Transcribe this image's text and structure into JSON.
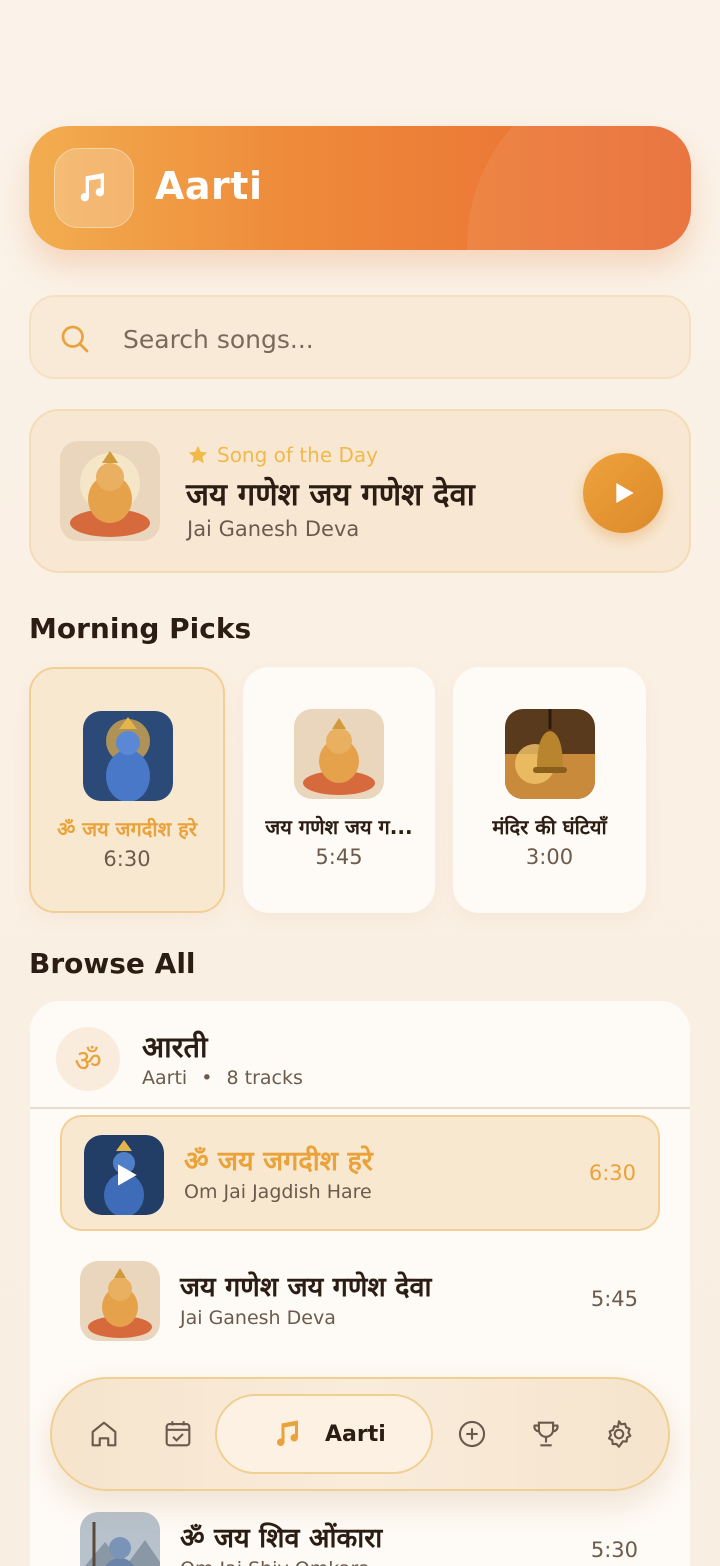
{
  "header": {
    "title": "Aarti",
    "icon": "music-note-icon"
  },
  "search": {
    "placeholder": "Search songs..."
  },
  "song_of_day": {
    "label": "Song of the Day",
    "title": "जय गणेश जय गणेश देवा",
    "subtitle": "Jai Ganesh Deva"
  },
  "morning_picks": {
    "title": "Morning Picks",
    "items": [
      {
        "title": "ॐ जय जगदीश हरे",
        "duration": "6:30"
      },
      {
        "title": "जय गणेश जय ग...",
        "duration": "5:45"
      },
      {
        "title": "मंदिर की घंटियाँ",
        "duration": "3:00"
      }
    ]
  },
  "browse": {
    "title": "Browse All",
    "category": {
      "symbol": "ॐ",
      "title": "आरती",
      "subtitle": "Aarti",
      "separator": "•",
      "count": "8 tracks"
    },
    "tracks": [
      {
        "title": "ॐ जय जगदीश हरे",
        "subtitle": "Om Jai Jagdish Hare",
        "duration": "6:30"
      },
      {
        "title": "जय गणेश जय गणेश देवा",
        "subtitle": "Jai Ganesh Deva",
        "duration": "5:45"
      },
      {
        "title": "ॐ जय शिव ओंकारा",
        "subtitle": "Om Jai Shiv Omkara",
        "duration": "5:30"
      }
    ]
  },
  "nav": {
    "active_label": "Aarti"
  },
  "colors": {
    "accent": "#eaa23a",
    "header_start": "#f2ad50",
    "header_end": "#e96b33"
  }
}
